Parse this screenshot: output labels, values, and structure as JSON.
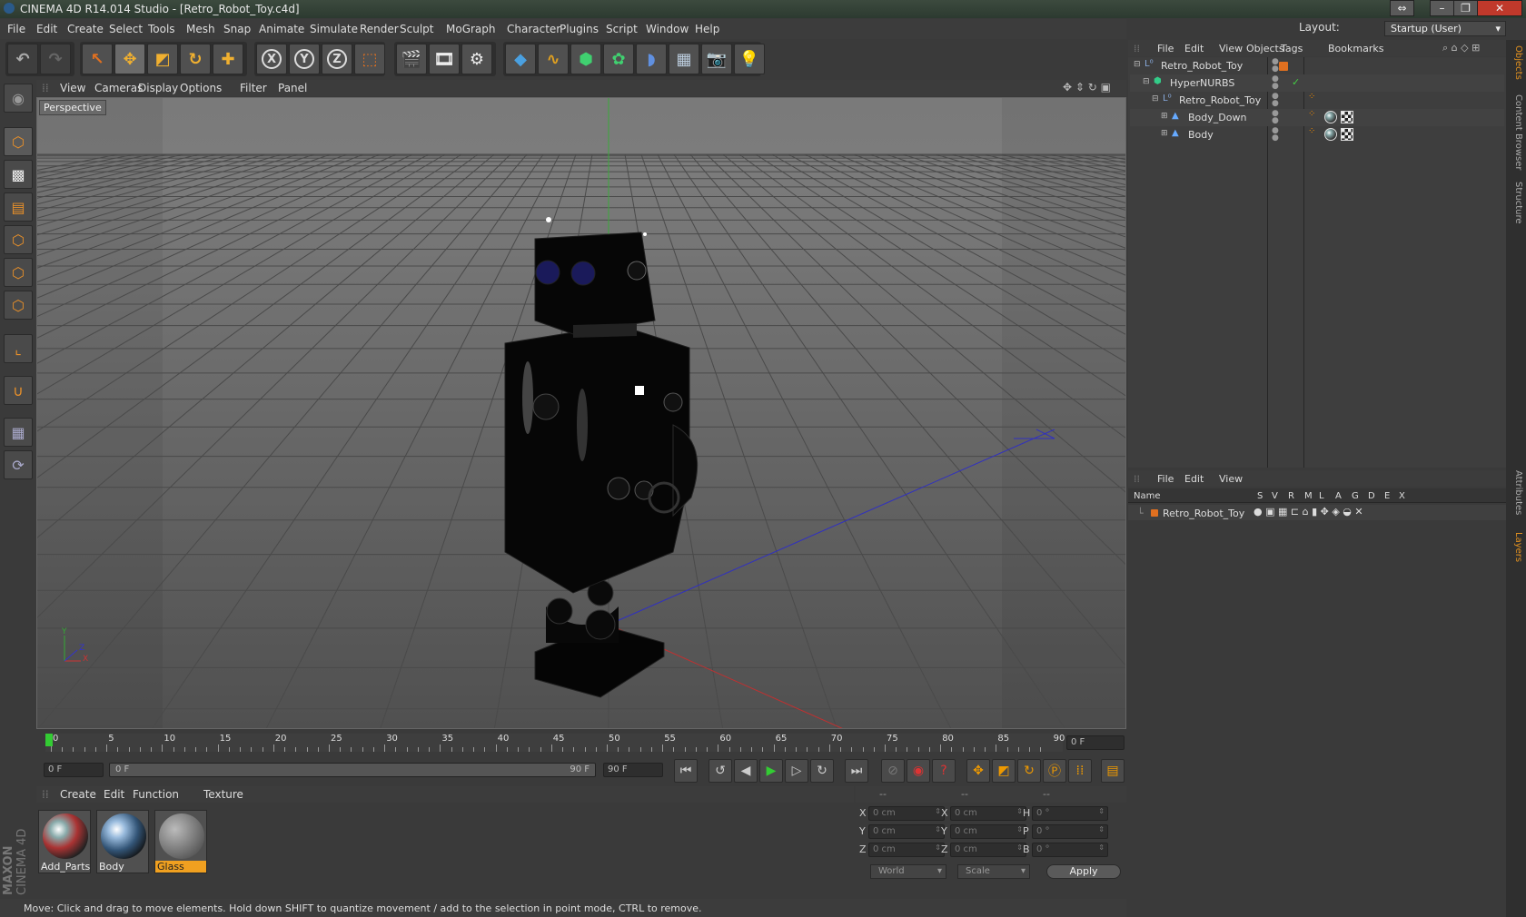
{
  "window": {
    "title": "CINEMA 4D R14.014 Studio - [Retro_Robot_Toy.c4d]"
  },
  "menubar": [
    "File",
    "Edit",
    "Create",
    "Select",
    "Tools",
    "Mesh",
    "Snap",
    "Animate",
    "Simulate",
    "Render",
    "Sculpt",
    "MoGraph",
    "Character",
    "Plugins",
    "Script",
    "Window",
    "Help"
  ],
  "layout": {
    "label": "Layout:",
    "value": "Startup (User)"
  },
  "axis_buttons": {
    "x": "X",
    "y": "Y",
    "z": "Z"
  },
  "viewport": {
    "menu": [
      "View",
      "Cameras",
      "Display",
      "Options",
      "Filter",
      "Panel"
    ],
    "label": "Perspective"
  },
  "timeline": {
    "ticks": [
      "0",
      "5",
      "10",
      "15",
      "20",
      "25",
      "30",
      "35",
      "40",
      "45",
      "50",
      "55",
      "60",
      "65",
      "70",
      "75",
      "80",
      "85",
      "90"
    ],
    "current_frame": "0 F"
  },
  "controls": {
    "start": "0 F",
    "range_start": "0 F",
    "range_end": "90 F",
    "end": "90 F"
  },
  "materials": {
    "menu": [
      "Create",
      "Edit",
      "Function",
      "Texture"
    ],
    "items": [
      {
        "name": "Add_Parts",
        "selected": false
      },
      {
        "name": "Body",
        "selected": false
      },
      {
        "name": "Glass",
        "selected": true
      }
    ]
  },
  "coordinates": {
    "headers": [
      "--",
      "--",
      "--"
    ],
    "rows": [
      {
        "a": "X",
        "av": "0 cm",
        "b": "X",
        "bv": "0 cm",
        "c": "H",
        "cv": "0 °"
      },
      {
        "a": "Y",
        "av": "0 cm",
        "b": "Y",
        "bv": "0 cm",
        "c": "P",
        "cv": "0 °"
      },
      {
        "a": "Z",
        "av": "0 cm",
        "b": "Z",
        "bv": "0 cm",
        "c": "B",
        "cv": "0 °"
      }
    ],
    "world": "World",
    "scale": "Scale",
    "apply": "Apply"
  },
  "status": "Move: Click and drag to move elements. Hold down SHIFT to quantize movement / add to the selection in point mode, CTRL to remove.",
  "objects": {
    "menu": [
      "File",
      "Edit",
      "View",
      "Objects",
      "Tags",
      "Bookmarks"
    ],
    "items": [
      {
        "name": "Retro_Robot_Toy"
      },
      {
        "name": "HyperNURBS"
      },
      {
        "name": "Retro_Robot_Toy"
      },
      {
        "name": "Body_Down"
      },
      {
        "name": "Body"
      }
    ]
  },
  "layers": {
    "menu": [
      "File",
      "Edit",
      "View"
    ],
    "headers": [
      "Name",
      "S",
      "V",
      "R",
      "M",
      "L",
      "A",
      "G",
      "D",
      "E",
      "X"
    ],
    "rows": [
      {
        "name": "Retro_Robot_Toy"
      }
    ]
  },
  "sidetabs": [
    "Objects",
    "Content Browser",
    "Structure",
    "Attributes",
    "Layers"
  ],
  "logo": {
    "brand": "MAXON",
    "product": "CINEMA 4D"
  }
}
